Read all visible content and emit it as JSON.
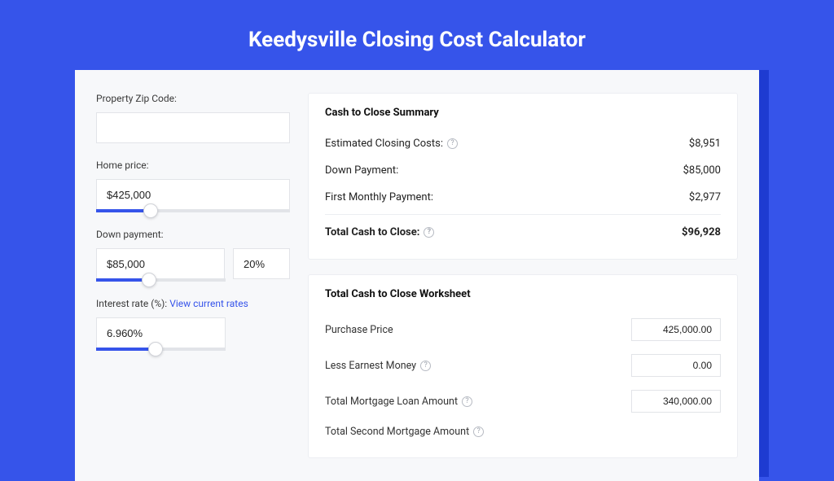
{
  "page": {
    "title": "Keedysville Closing Cost Calculator"
  },
  "inputs": {
    "zip_label": "Property Zip Code:",
    "zip_value": "",
    "home_price_label": "Home price:",
    "home_price_value": "$425,000",
    "down_payment_label": "Down payment:",
    "down_payment_value": "$85,000",
    "down_payment_pct": "20%",
    "interest_label_prefix": "Interest rate (%): ",
    "interest_link": "View current rates",
    "interest_value": "6.960%"
  },
  "summary": {
    "title": "Cash to Close Summary",
    "rows": {
      "closing_costs_label": "Estimated Closing Costs:",
      "closing_costs_value": "$8,951",
      "down_payment_label": "Down Payment:",
      "down_payment_value": "$85,000",
      "first_payment_label": "First Monthly Payment:",
      "first_payment_value": "$2,977",
      "total_label": "Total Cash to Close:",
      "total_value": "$96,928"
    }
  },
  "worksheet": {
    "title": "Total Cash to Close Worksheet",
    "purchase_price_label": "Purchase Price",
    "purchase_price_value": "425,000.00",
    "earnest_label": "Less Earnest Money",
    "earnest_value": "0.00",
    "total_mortgage_label": "Total Mortgage Loan Amount",
    "total_mortgage_value": "340,000.00",
    "second_mortgage_label": "Total Second Mortgage Amount"
  }
}
